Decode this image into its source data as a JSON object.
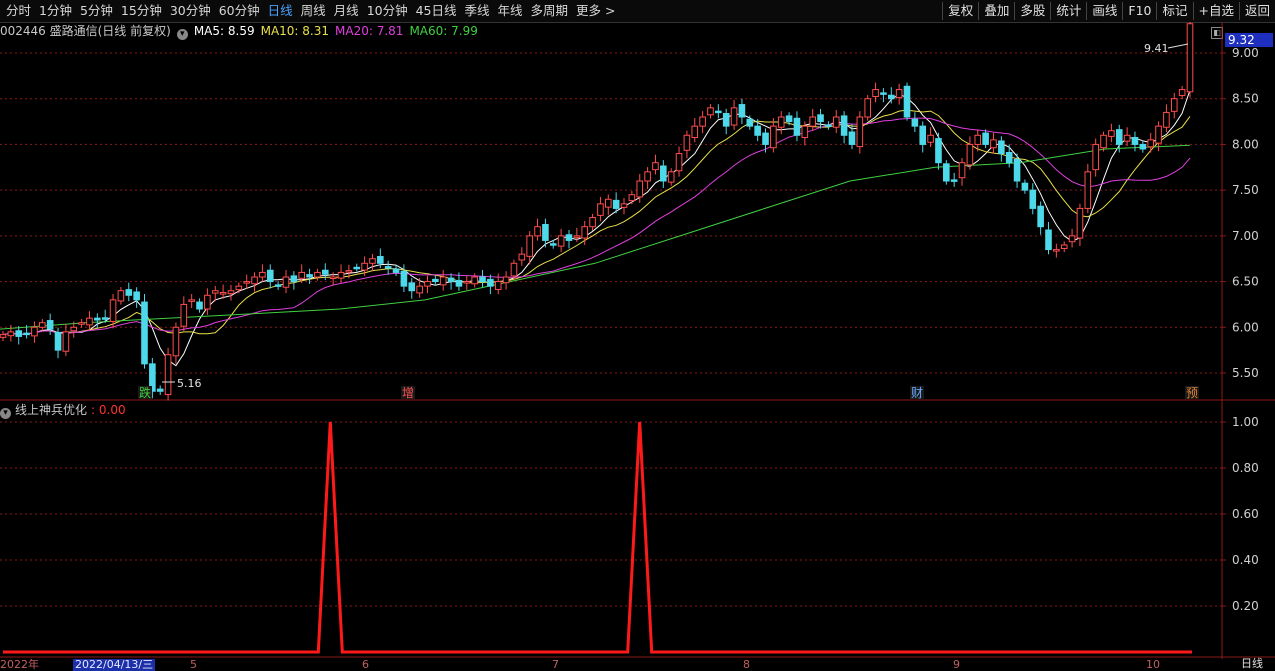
{
  "toolbar": {
    "periods": [
      "分时",
      "1分钟",
      "5分钟",
      "15分钟",
      "30分钟",
      "60分钟",
      "日线",
      "周线",
      "月线",
      "10分钟",
      "45日线",
      "季线",
      "年线",
      "多周期",
      "更多 >"
    ],
    "active_period": "日线",
    "right_buttons": [
      "复权",
      "叠加",
      "多股",
      "统计",
      "画线",
      "F10",
      "标记",
      "+自选",
      "返回"
    ]
  },
  "stock": {
    "title": "002446 盛路通信(日线 前复权)",
    "ma5_label": "MA5: 8.59",
    "ma10_label": "MA10: 8.31",
    "ma20_label": "MA20: 7.81",
    "ma60_label": "MA60: 7.99",
    "current_price": "9.32",
    "high_label": "9.41",
    "low_label": "5.16"
  },
  "colors": {
    "up": "#ff4d4d",
    "down": "#4dd9ea",
    "ma5": "#ffffff",
    "ma10": "#e8e04a",
    "ma20": "#e040e0",
    "ma60": "#40d040",
    "indicator": "#ff1a1a",
    "grid": "#8b1a1a"
  },
  "price_axis": {
    "ticks": [
      "9.00",
      "8.50",
      "8.00",
      "7.50",
      "7.00",
      "6.50",
      "6.00",
      "5.50"
    ],
    "min": 5.16,
    "max": 9.41
  },
  "markers": [
    {
      "text": "跌",
      "color": "#40d040"
    },
    {
      "text": "增",
      "color": "#ff5050"
    },
    {
      "text": "财",
      "color": "#6aaaff"
    },
    {
      "text": "预",
      "color": "#e08030"
    }
  ],
  "indicator": {
    "name": "线上神兵优化",
    "value": ": 0.00",
    "ticks": [
      "1.00",
      "0.80",
      "0.60",
      "0.40",
      "0.20"
    ]
  },
  "x_axis": {
    "labels": [
      "2022年",
      "5",
      "6",
      "7",
      "8",
      "9",
      "10"
    ],
    "selected_date": "2022/04/13/三",
    "period_label": "日线"
  },
  "chart_data": {
    "type": "candlestick",
    "closes": [
      5.92,
      5.95,
      5.9,
      5.93,
      6.0,
      6.05,
      5.98,
      5.75,
      5.95,
      6.0,
      6.05,
      6.1,
      6.08,
      6.1,
      6.3,
      6.4,
      6.35,
      6.3,
      5.6,
      5.3,
      5.3,
      5.7,
      6.0,
      6.25,
      6.3,
      6.2,
      6.35,
      6.4,
      6.38,
      6.4,
      6.45,
      6.5,
      6.55,
      6.6,
      6.5,
      6.45,
      6.55,
      6.5,
      6.6,
      6.55,
      6.6,
      6.58,
      6.55,
      6.6,
      6.62,
      6.65,
      6.7,
      6.75,
      6.7,
      6.65,
      6.6,
      6.45,
      6.4,
      6.45,
      6.5,
      6.5,
      6.55,
      6.5,
      6.45,
      6.5,
      6.55,
      6.5,
      6.45,
      6.5,
      6.55,
      6.7,
      6.8,
      7.0,
      7.1,
      6.95,
      6.9,
      7.0,
      6.95,
      7.0,
      7.1,
      7.2,
      7.35,
      7.4,
      7.3,
      7.35,
      7.45,
      7.6,
      7.7,
      7.8,
      7.6,
      7.7,
      7.9,
      8.1,
      8.2,
      8.3,
      8.4,
      8.35,
      8.2,
      8.4,
      8.3,
      8.2,
      8.1,
      8.0,
      8.2,
      8.3,
      8.25,
      8.1,
      8.2,
      8.3,
      8.25,
      8.2,
      8.3,
      8.1,
      8.0,
      8.3,
      8.5,
      8.6,
      8.55,
      8.5,
      8.6,
      8.3,
      8.2,
      8.0,
      8.1,
      7.8,
      7.6,
      7.6,
      7.8,
      8.0,
      8.1,
      8.0,
      8.05,
      7.9,
      7.8,
      7.6,
      7.5,
      7.3,
      7.1,
      6.85,
      6.85,
      6.9,
      7.0,
      7.3,
      7.7,
      8.0,
      8.1,
      8.15,
      8.0,
      8.1,
      8.0,
      7.95,
      8.05,
      8.2,
      8.35,
      8.5,
      8.6,
      9.32
    ],
    "ma60": [
      5.98,
      6.05,
      6.1,
      6.15,
      6.2,
      6.3,
      6.5,
      6.7,
      7.0,
      7.3,
      7.6,
      7.75,
      7.8,
      7.95,
      7.99
    ],
    "indicator_spikes": [
      {
        "pos": 0.275,
        "value": 1.0
      },
      {
        "pos": 0.535,
        "value": 1.0
      }
    ],
    "indicator_range": [
      0,
      1
    ]
  }
}
